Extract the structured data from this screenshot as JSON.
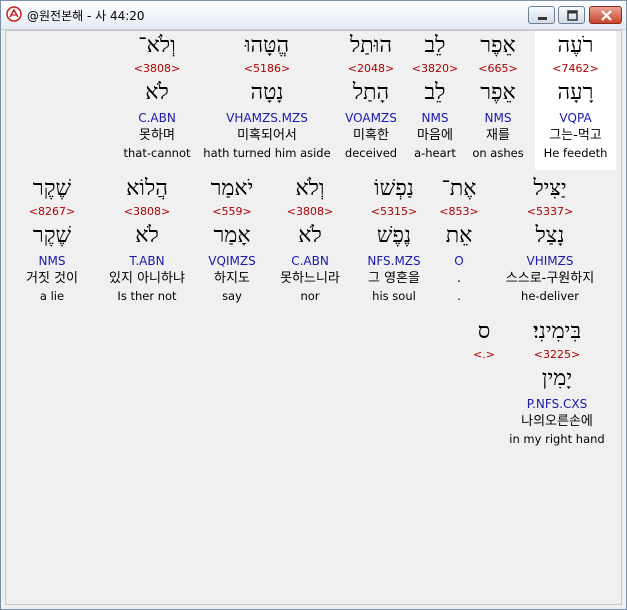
{
  "window": {
    "title": "@원전본해 - 사 44:20"
  },
  "rows": [
    {
      "words": [
        {
          "heb": "רֹעֶה",
          "strong": "<7462>",
          "lex": "רָעָה",
          "morph": "VQPA",
          "kor": "그는-먹고",
          "eng": "He feedeth"
        },
        {
          "heb": "אֵפֶר",
          "strong": "<665>",
          "lex": "אֵפֶר",
          "morph": "NMS",
          "kor": "재를",
          "eng": "on ashes"
        },
        {
          "heb": "לֵב",
          "strong": "<3820>",
          "lex": "לֵב",
          "morph": "NMS",
          "kor": "마음에",
          "eng": "a-heart"
        },
        {
          "heb": "הוּתַל",
          "strong": "<2048>",
          "lex": "הָתַל",
          "morph": "VOAMZS",
          "kor": "미혹한",
          "eng": "deceived"
        },
        {
          "heb": "הֱטָּהוּ",
          "strong": "<5186>",
          "lex": "נָטָה",
          "morph": "VHAMZS.MZS",
          "kor": "미혹되어서",
          "eng": "hath turned him aside"
        },
        {
          "heb": "וְלֹא־",
          "strong": "<3808>",
          "lex": "לֹא",
          "morph": "C.ABN",
          "kor": "못하며",
          "eng": "that-cannot"
        }
      ]
    },
    {
      "words": [
        {
          "heb": "יַצִּיל",
          "strong": "<5337>",
          "lex": "נָצַל",
          "morph": "VHIMZS",
          "kor": "스스로-구원하지",
          "eng": "he-deliver"
        },
        {
          "heb": "אֶת־",
          "strong": "<853>",
          "lex": "אֵת",
          "morph": "O",
          "kor": ".",
          "eng": "."
        },
        {
          "heb": "נַפְשׁוֹ",
          "strong": "<5315>",
          "lex": "נֶפֶשׁ",
          "morph": "NFS.MZS",
          "kor": "그 영혼을",
          "eng": "his soul"
        },
        {
          "heb": "וְלֹא",
          "strong": "<3808>",
          "lex": "לֹא",
          "morph": "C.ABN",
          "kor": "못하느니라",
          "eng": "nor"
        },
        {
          "heb": "יֹאמַר",
          "strong": "<559>",
          "lex": "אָמַר",
          "morph": "VQIMZS",
          "kor": "하지도",
          "eng": "say"
        },
        {
          "heb": "הֲלוֹא",
          "strong": "<3808>",
          "lex": "לֹא",
          "morph": "T.ABN",
          "kor": "있지 아니하냐",
          "eng": "Is ther not"
        },
        {
          "heb": "שֶׁקֶר",
          "strong": "<8267>",
          "lex": "שֶׁקֶר",
          "morph": "NMS",
          "kor": "거짓 것이",
          "eng": "a lie"
        }
      ]
    },
    {
      "words": [
        {
          "heb": "בִּימִינִי׃",
          "strong": "<3225>",
          "lex": "יָמִין",
          "morph": "P.NFS.CXS",
          "kor": "나의오른손에",
          "eng": "in my right hand"
        },
        {
          "heb": "ס",
          "strong": "<.>",
          "lex": "",
          "morph": "",
          "kor": "",
          "eng": ""
        }
      ]
    }
  ],
  "colors": {
    "strong": "#b00000",
    "morph": "#1a1ab0",
    "highlight": "#ffffff"
  }
}
